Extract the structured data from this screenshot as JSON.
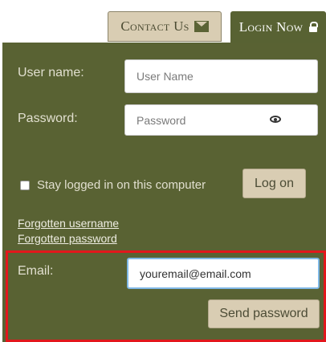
{
  "tabs": {
    "contact_label": "Contact Us",
    "login_label": "Login Now"
  },
  "login_form": {
    "username_label": "User name:",
    "username_placeholder": "User Name",
    "password_label": "Password:",
    "password_placeholder": "Password",
    "stay_logged_label": "Stay logged in on this computer",
    "stay_logged_checked": false,
    "logon_button": "Log on",
    "forgot_username": "Forgotten username",
    "forgot_password": "Forgotten password"
  },
  "reset_form": {
    "email_label": "Email:",
    "email_value": "youremail@email.com",
    "send_button": "Send password"
  },
  "colors": {
    "panel": "#596233",
    "accent_button": "#d9cdb3",
    "highlight": "#e2171c"
  },
  "icons": [
    "envelope-icon",
    "lock-icon",
    "eye-icon"
  ]
}
